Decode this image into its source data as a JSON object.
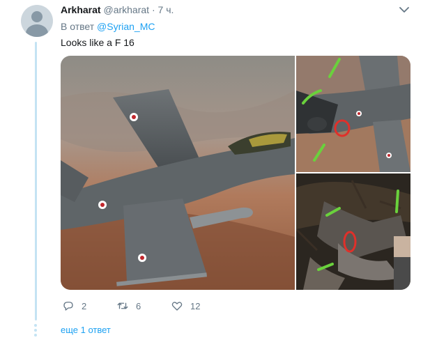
{
  "tweet": {
    "display_name": "Arkharat",
    "handle": "@arkharat",
    "separator": "·",
    "time": "7 ч.",
    "reply_prefix": "В ответ",
    "reply_mention": "@Syrian_MC",
    "text": "Looks like a F 16"
  },
  "actions": {
    "replies": "2",
    "retweets": "6",
    "likes": "12"
  },
  "more_replies": "еще 1 ответ",
  "colors": {
    "accent": "#1da1f2",
    "muted": "#657786",
    "thread": "#c4e3f3"
  },
  "icons": [
    "chevron-down-icon",
    "reply-icon",
    "retweet-icon",
    "like-icon"
  ]
}
